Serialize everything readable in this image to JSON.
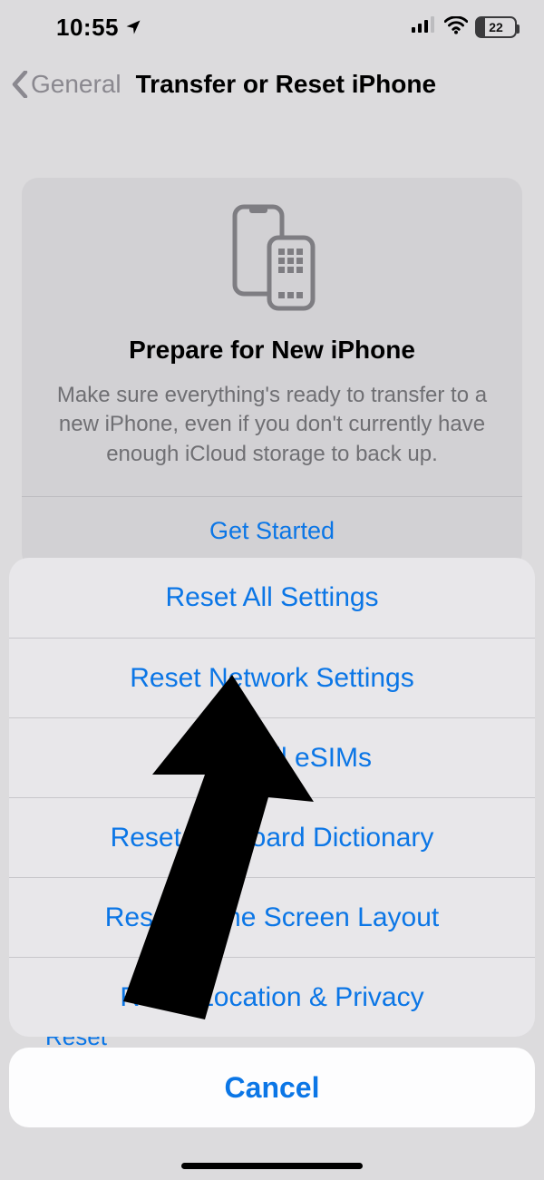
{
  "status": {
    "time": "10:55",
    "battery": "22"
  },
  "nav": {
    "back_label": "General",
    "title": "Transfer or Reset iPhone"
  },
  "card": {
    "title": "Prepare for New iPhone",
    "description": "Make sure everything's ready to transfer to a new iPhone, even if you don't currently have enough iCloud storage to back up.",
    "cta": "Get Started"
  },
  "peek": {
    "reset": "Reset"
  },
  "sheet": {
    "items": [
      "Reset All Settings",
      "Reset Network Settings",
      "Delete All eSIMs",
      "Reset Keyboard Dictionary",
      "Reset Home Screen Layout",
      "Reset Location & Privacy"
    ],
    "cancel": "Cancel"
  }
}
